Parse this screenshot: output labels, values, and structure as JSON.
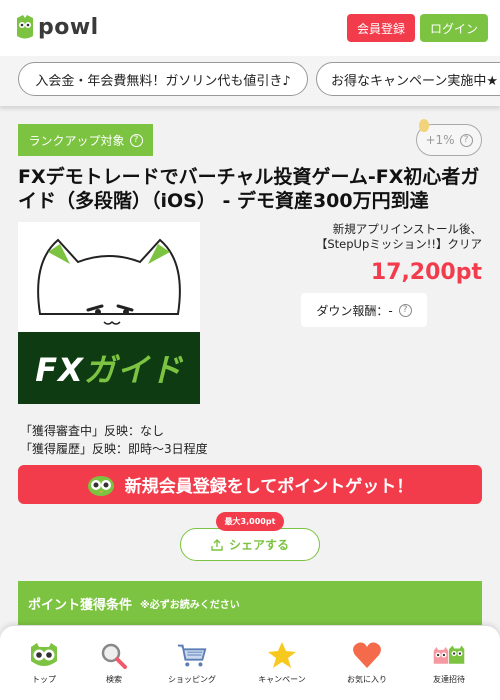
{
  "header": {
    "logo_text": "powl",
    "register_label": "会員登録",
    "login_label": "ログイン"
  },
  "ticker": {
    "items": [
      "入会金・年会費無料！ガソリン代も値引き♪",
      "お得なキャンペーン実施中★"
    ]
  },
  "offer": {
    "rank_badge": "ランクアップ対象",
    "bonus_label": "+1%",
    "title": "FXデモトレードでバーチャル投資ゲーム-FX初心者ガイド（多段階）（iOS） - デモ資産300万円到達",
    "thumbnail_text_a": "FX",
    "thumbnail_text_b": "ガイド",
    "condition_line1": "新規アプリインストール後、",
    "condition_line2": "【StepUpミッション!!】クリア",
    "points": "17,200pt",
    "down_reward_label": "ダウン報酬：-",
    "status_line1": "「獲得審査中」反映：なし",
    "status_line2": "「獲得履歴」反映：即時〜3日程度"
  },
  "cta": {
    "label": "新規会員登録をしてポイントゲット！"
  },
  "share": {
    "badge": "最大3,000pt",
    "label": "シェアする"
  },
  "conditions": {
    "heading": "ポイント獲得条件",
    "note": "※必ずお読みください"
  },
  "bottom_nav": {
    "items": [
      {
        "label": "トップ",
        "icon": "owl-icon"
      },
      {
        "label": "検索",
        "icon": "search-icon"
      },
      {
        "label": "ショッピング",
        "icon": "cart-icon"
      },
      {
        "label": "キャンペーン",
        "icon": "star-icon"
      },
      {
        "label": "お気に入り",
        "icon": "heart-icon"
      },
      {
        "label": "友達招待",
        "icon": "friends-icon"
      }
    ]
  },
  "colors": {
    "brand_green": "#7cc341",
    "accent_red": "#f23c4c",
    "thumb_dark_green": "#0e3b12"
  }
}
